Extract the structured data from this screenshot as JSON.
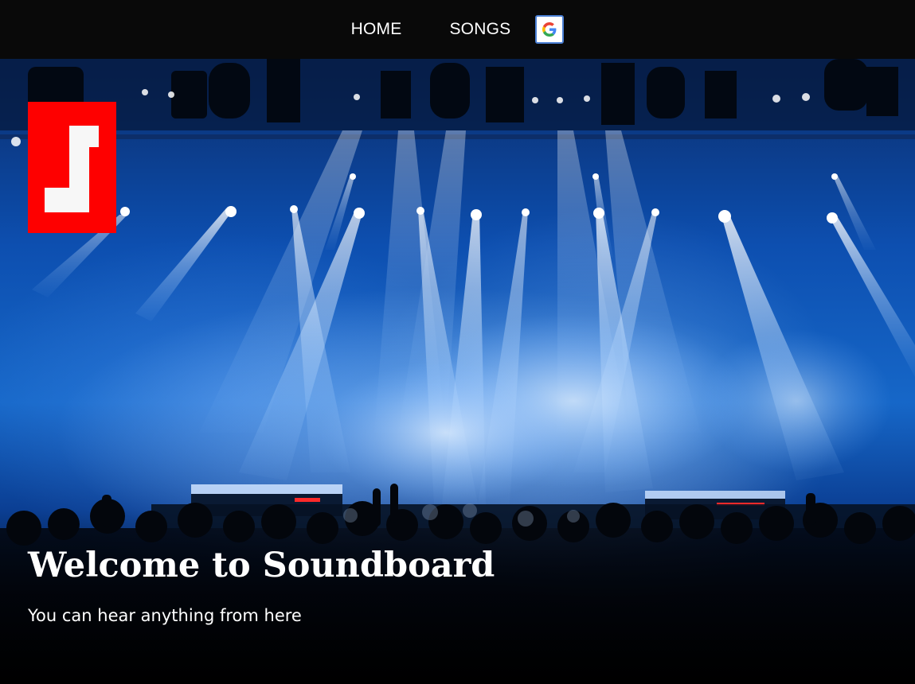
{
  "nav": {
    "home_label": "HOME",
    "songs_label": "SONGS",
    "google_icon": "google-icon"
  },
  "logo": {
    "icon": "soundboard-logo-icon",
    "color": "#fe0000"
  },
  "hero": {
    "background": "concert-stage-image",
    "title": "Welcome to Soundboard",
    "subtitle": "You can hear anything from here"
  },
  "colors": {
    "nav_background": "#090909",
    "google_border": "#4a7fd4",
    "logo_red": "#fe0000"
  }
}
